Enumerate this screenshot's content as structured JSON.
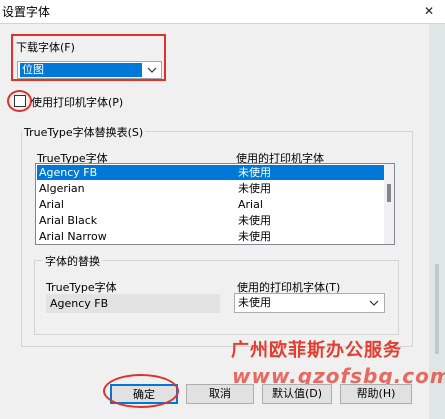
{
  "window": {
    "title": "设置字体",
    "close_glyph": "✕"
  },
  "download_font": {
    "label": "下载字体(F)",
    "selected": "位图"
  },
  "use_printer_font": {
    "label": "使用打印机字体(P)",
    "checked": false
  },
  "substitution_table": {
    "label": "TrueType字体替换表(S)",
    "columns": [
      "TrueType字体",
      "使用的打印机字体"
    ],
    "rows": [
      {
        "font": "Agency FB",
        "printer": "未使用",
        "selected": true
      },
      {
        "font": "Algerian",
        "printer": "未使用",
        "selected": false
      },
      {
        "font": "Arial",
        "printer": "Arial",
        "selected": false
      },
      {
        "font": "Arial Black",
        "printer": "未使用",
        "selected": false
      },
      {
        "font": "Arial Narrow",
        "printer": "未使用",
        "selected": false
      }
    ]
  },
  "font_substitution": {
    "label": "字体的替换",
    "truetype_label": "TrueType字体",
    "truetype_value": "Agency FB",
    "printer_label": "使用的打印机字体(T)",
    "printer_value": "未使用"
  },
  "watermark": {
    "line1": "广州欧菲斯办公服务",
    "line2": "www.gzofsbg.com"
  },
  "buttons": {
    "ok": "确定",
    "cancel": "取消",
    "default": "默认值(D)",
    "help": "帮助(H)"
  },
  "colors": {
    "highlight": "#0078d7",
    "annotation": "#e0312b"
  }
}
